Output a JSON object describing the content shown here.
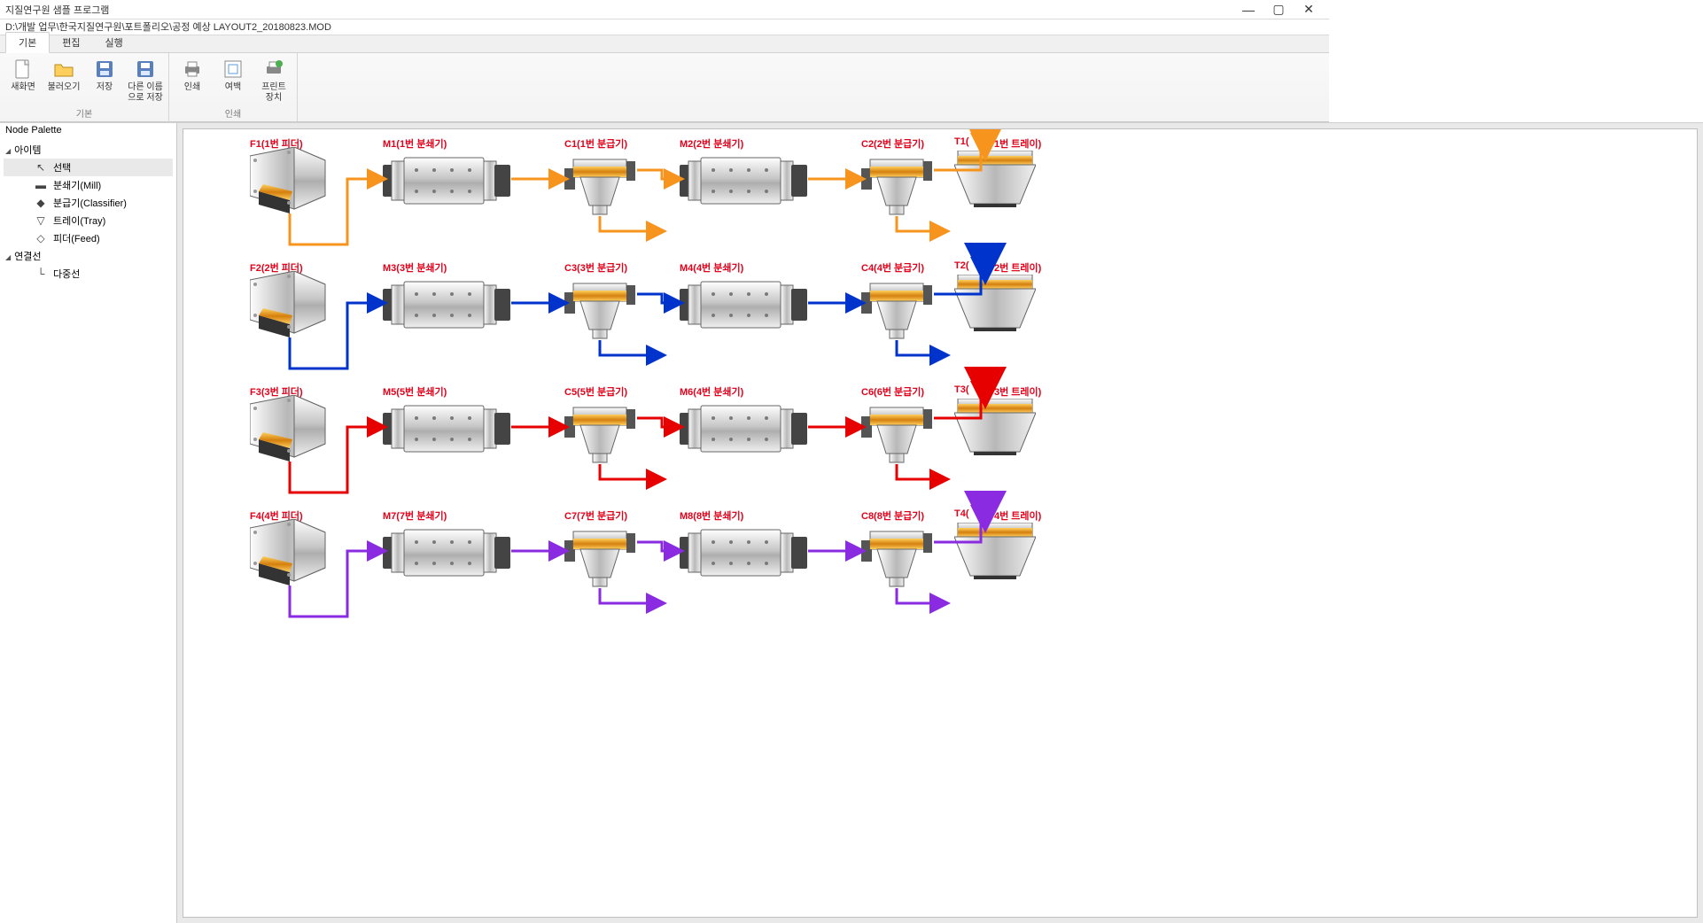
{
  "window": {
    "title": "지질연구원 샘플 프로그램"
  },
  "path": "D:\\개발 업무\\한국지질연구원\\포트폴리오\\공정 예상 LAYOUT2_20180823.MOD",
  "tabs": {
    "items": [
      "기본",
      "편집",
      "실행"
    ],
    "active": 0
  },
  "ribbon": {
    "groups": [
      {
        "label": "기본",
        "buttons": [
          "새화면",
          "불러오기",
          "저장",
          "다른 이름\n으로 저장"
        ]
      },
      {
        "label": "인쇄",
        "buttons": [
          "인쇄",
          "여백",
          "프린트\n장치"
        ]
      }
    ]
  },
  "palette": {
    "title": "Node Palette",
    "groups": [
      {
        "name": "아이템",
        "items": [
          "선택",
          "분쇄기(Mill)",
          "분급기(Classifier)",
          "트레이(Tray)",
          "피더(Feed)"
        ]
      },
      {
        "name": "연결선",
        "items": [
          "다중선"
        ]
      }
    ],
    "selected": "선택"
  },
  "colors": {
    "row1": "#f7941d",
    "row2": "#0033cc",
    "row3": "#e60000",
    "row4": "#8a2be2"
  },
  "rows": [
    {
      "labels": [
        "F1(1번 피더)",
        "M1(1번 분쇄기)",
        "C1(1번 분급기)",
        "M2(2번 분쇄기)",
        "C2(2번 분급기)",
        "T1(",
        "1번 트레이)"
      ]
    },
    {
      "labels": [
        "F2(2번 피더)",
        "M3(3번 분쇄기)",
        "C3(3번 분급기)",
        "M4(4번 분쇄기)",
        "C4(4번 분급기)",
        "T2(",
        "2번 트레이)"
      ]
    },
    {
      "labels": [
        "F3(3번 피더)",
        "M5(5번 분쇄기)",
        "C5(5번 분급기)",
        "M6(4번 분쇄기)",
        "C6(6번 분급기)",
        "T3(",
        "3번 트레이)"
      ]
    },
    {
      "labels": [
        "F4(4번 피더)",
        "M7(7번 분쇄기)",
        "C7(7번 분급기)",
        "M8(8번 분쇄기)",
        "C8(8번 분급기)",
        "T4(",
        "4번 트레이)"
      ]
    }
  ]
}
